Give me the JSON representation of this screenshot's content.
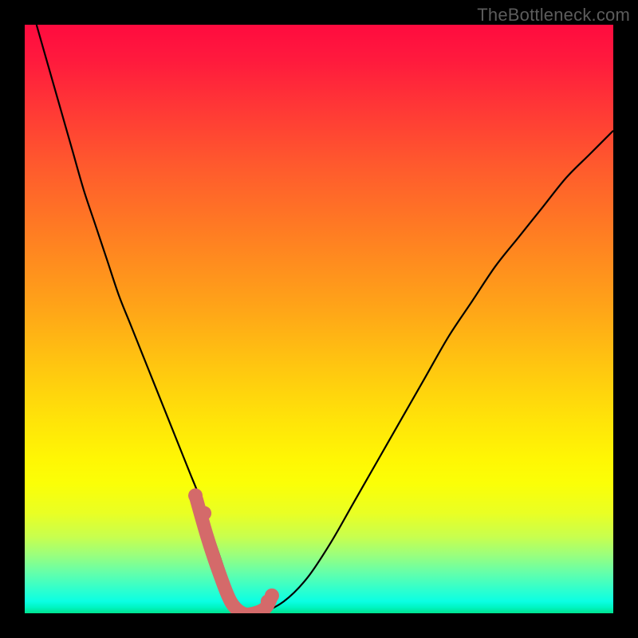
{
  "branding": {
    "text": "TheBottleneck.com"
  },
  "colors": {
    "curve_stroke": "#000000",
    "marker_stroke": "#d46a6a",
    "marker_fill": "#d46a6a",
    "background": "#000000"
  },
  "chart_data": {
    "type": "line",
    "title": "",
    "xlabel": "",
    "ylabel": "",
    "xlim": [
      0,
      100
    ],
    "ylim": [
      0,
      100
    ],
    "grid": false,
    "series": [
      {
        "name": "bottleneck-curve",
        "x": [
          2,
          4,
          6,
          8,
          10,
          12,
          14,
          16,
          18,
          20,
          22,
          24,
          26,
          28,
          30,
          32,
          34,
          35,
          36,
          38,
          40,
          44,
          48,
          52,
          56,
          60,
          64,
          68,
          72,
          76,
          80,
          84,
          88,
          92,
          96,
          100
        ],
        "y": [
          100,
          93,
          86,
          79,
          72,
          66,
          60,
          54,
          49,
          44,
          39,
          34,
          29,
          24,
          19,
          13,
          7,
          3,
          1,
          0,
          0,
          2,
          6,
          12,
          19,
          26,
          33,
          40,
          47,
          53,
          59,
          64,
          69,
          74,
          78,
          82
        ]
      }
    ],
    "markers": {
      "name": "highlight-points",
      "x_range": [
        29,
        42
      ],
      "points_x": [
        29,
        31,
        33,
        35,
        37,
        39,
        41,
        42
      ],
      "points_y": [
        20,
        13,
        7,
        2,
        0,
        0,
        1,
        3
      ]
    }
  }
}
